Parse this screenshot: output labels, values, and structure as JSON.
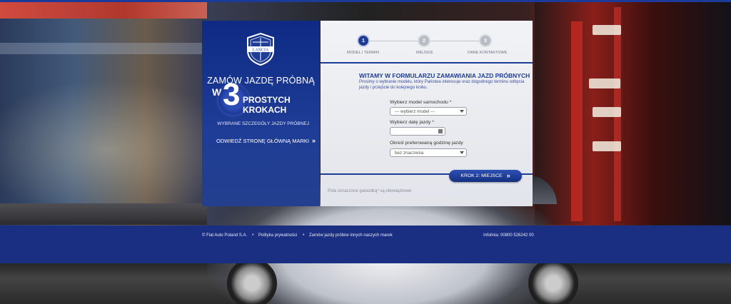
{
  "brand": {
    "logo_text": "LANCIA"
  },
  "left_panel": {
    "headline_line1": "ZAMÓW JAZDĘ PRÓBNĄ",
    "headline_w": "W",
    "headline_number": "3",
    "headline_line2": "PROSTYCH KROKACH",
    "selected_details": "WYBRANE SZCZEGÓŁY JAZDY PRÓBNEJ",
    "brand_link": "ODWIEDŹ STRONĘ GŁÓWNĄ MARKI"
  },
  "steps": [
    {
      "number": "1",
      "label": "MODEL I TERMIN",
      "active": true
    },
    {
      "number": "2",
      "label": "MIEJSCE",
      "active": false
    },
    {
      "number": "3",
      "label": "DANE KONTAKTOWE",
      "active": false
    }
  ],
  "form": {
    "title": "WITAMY W FORMULARZU ZAMAWIANIA JAZD PRÓBNYCH",
    "intro": "Prosimy o wybranie modelu, który Państwa interesuje oraz dogodnego terminu odbycia jazdy i przejście do kolejnego kroku.",
    "model_label": "Wybierz model samochodu *",
    "model_value": "--- wybierz model ---",
    "date_label": "Wybierz datę jazdy *",
    "date_value": "",
    "time_label": "Określ preferowaną godzinę jazdy",
    "time_value": "bez znaczenia",
    "next_button": "KROK 2: MIEJSCE",
    "required_note": "Pola oznaczone gwiazdką* są obowiązkowe"
  },
  "footer": {
    "copyright": "© Fiat Auto Poland S.A.",
    "privacy": "Polityka prywatności",
    "other_brands": "Zamów jazdy próbne innych naszych marek",
    "hotline": "Infolinia: 00800 526242 00"
  },
  "colors": {
    "brand_blue": "#1f3d96",
    "footer_blue": "#1b2f82"
  }
}
